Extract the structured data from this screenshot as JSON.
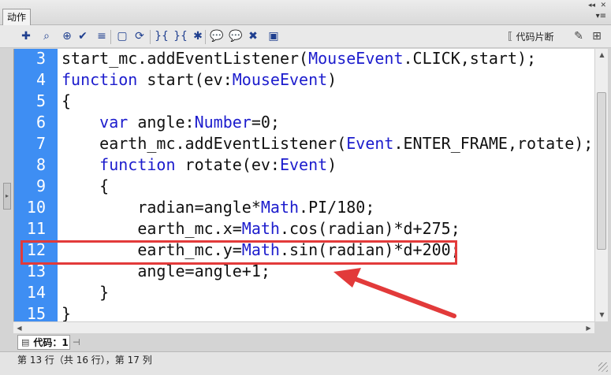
{
  "panel": {
    "tab_label": "动作",
    "collapse_glyph": "◂◂",
    "close_glyph": "✕",
    "menu_glyph": "▾≡"
  },
  "toolbar": {
    "icons": [
      "add-statement-icon",
      "find-icon",
      "target-icon",
      "check-syntax-icon",
      "auto-format-icon",
      "code-hint-icon",
      "debug-icon",
      "collapse-between-icon",
      "collapse-selection-icon",
      "expand-all-icon",
      "apply-block-comment-icon",
      "apply-line-comment-icon",
      "remove-comment-icon",
      "show-hide-toolbox-icon"
    ],
    "icon_glyphs": [
      "✚",
      "⌕",
      "⊕",
      "✔",
      "≡",
      "▢",
      "⟳",
      "}{",
      "}{",
      "✱",
      "💬",
      "💬",
      "✖",
      "▣"
    ],
    "snippets_label": "代码片断",
    "snippets_icon": "⟦",
    "wand_icon": "✎"
  },
  "editor": {
    "lines": [
      {
        "n": "3",
        "parts": [
          [
            "start_mc.addEventListener(",
            "p"
          ],
          [
            "MouseEvent",
            "t"
          ],
          [
            ".CLICK,start);",
            "p"
          ]
        ]
      },
      {
        "n": "4",
        "parts": [
          [
            "function",
            "k"
          ],
          [
            " start(ev:",
            "p"
          ],
          [
            "MouseEvent",
            "t"
          ],
          [
            ")",
            "p"
          ]
        ]
      },
      {
        "n": "5",
        "parts": [
          [
            "{",
            "p"
          ]
        ]
      },
      {
        "n": "6",
        "parts": [
          [
            "    ",
            "p"
          ],
          [
            "var",
            "k"
          ],
          [
            " angle:",
            "p"
          ],
          [
            "Number",
            "t"
          ],
          [
            "=0;",
            "p"
          ]
        ]
      },
      {
        "n": "7",
        "parts": [
          [
            "    earth_mc.addEventListener(",
            "p"
          ],
          [
            "Event",
            "t"
          ],
          [
            ".ENTER_FRAME,rotate);",
            "p"
          ]
        ]
      },
      {
        "n": "8",
        "parts": [
          [
            "    ",
            "p"
          ],
          [
            "function",
            "k"
          ],
          [
            " rotate(ev:",
            "p"
          ],
          [
            "Event",
            "t"
          ],
          [
            ")",
            "p"
          ]
        ]
      },
      {
        "n": "9",
        "parts": [
          [
            "    {",
            "p"
          ]
        ]
      },
      {
        "n": "10",
        "parts": [
          [
            "        radian=angle*",
            "p"
          ],
          [
            "Math",
            "t"
          ],
          [
            ".PI/180;",
            "p"
          ]
        ]
      },
      {
        "n": "11",
        "parts": [
          [
            "        earth_mc.x=",
            "p"
          ],
          [
            "Math",
            "t"
          ],
          [
            ".cos(radian)*d+275;",
            "p"
          ]
        ]
      },
      {
        "n": "12",
        "parts": [
          [
            "        earth_mc.y=",
            "p"
          ],
          [
            "Math",
            "t"
          ],
          [
            ".sin(radian)*d+200;",
            "p"
          ]
        ]
      },
      {
        "n": "13",
        "parts": [
          [
            "        angle=angle+1;",
            "p"
          ]
        ]
      },
      {
        "n": "14",
        "parts": [
          [
            "    }",
            "p"
          ]
        ]
      },
      {
        "n": "15",
        "parts": [
          [
            "}",
            "p"
          ]
        ]
      }
    ],
    "highlighted_line": "12"
  },
  "bottom": {
    "code_tab_label": "代码：1",
    "code_tab_icon": "▤",
    "pin_icon": "⊣"
  },
  "status": {
    "text": "第 13 行（共 16 行），第 17 列"
  },
  "colors": {
    "gutter": "#3e8ef3",
    "keyword": "#1c1ccd",
    "annotation": "#e23a3a"
  }
}
